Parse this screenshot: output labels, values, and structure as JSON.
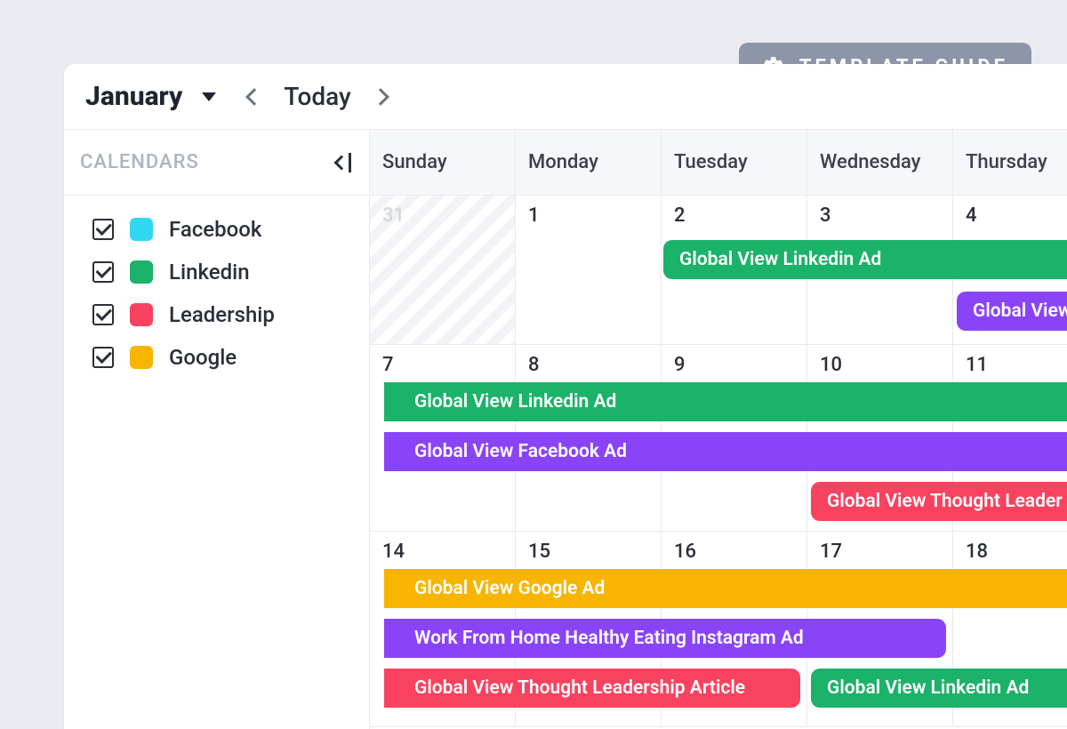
{
  "template_guide_label": "TEMPLATE GUIDE",
  "header": {
    "month_label": "January",
    "today_label": "Today"
  },
  "sidebar": {
    "title": "CALENDARS",
    "items": [
      {
        "label": "Facebook",
        "color": "#32d8f2"
      },
      {
        "label": "Linkedin",
        "color": "#1bb269"
      },
      {
        "label": "Leadership",
        "color": "#f9425f"
      },
      {
        "label": "Google",
        "color": "#f7b500"
      }
    ]
  },
  "days": [
    "Sunday",
    "Monday",
    "Tuesday",
    "Wednesday",
    "Thursday"
  ],
  "weeks": [
    {
      "dates": [
        "31",
        "1",
        "2",
        "3",
        "4"
      ],
      "out": [
        true,
        false,
        false,
        false,
        false
      ]
    },
    {
      "dates": [
        "7",
        "8",
        "9",
        "10",
        "11"
      ],
      "out": [
        false,
        false,
        false,
        false,
        false
      ]
    },
    {
      "dates": [
        "14",
        "15",
        "16",
        "17",
        "18"
      ],
      "out": [
        false,
        false,
        false,
        false,
        false
      ]
    }
  ],
  "events": {
    "w0": [
      {
        "label": "Global View Linkedin Ad"
      },
      {
        "label": "Global View"
      }
    ],
    "w1": [
      {
        "label": "Global View Linkedin Ad"
      },
      {
        "label": "Global View Facebook Ad"
      },
      {
        "label": "Global View Thought Leader"
      }
    ],
    "w2": [
      {
        "label": "Global View Google Ad"
      },
      {
        "label": "Work From Home Healthy Eating Instagram Ad"
      },
      {
        "label": "Global View Thought Leadership Article"
      },
      {
        "label": "Global View Linkedin Ad"
      }
    ]
  }
}
